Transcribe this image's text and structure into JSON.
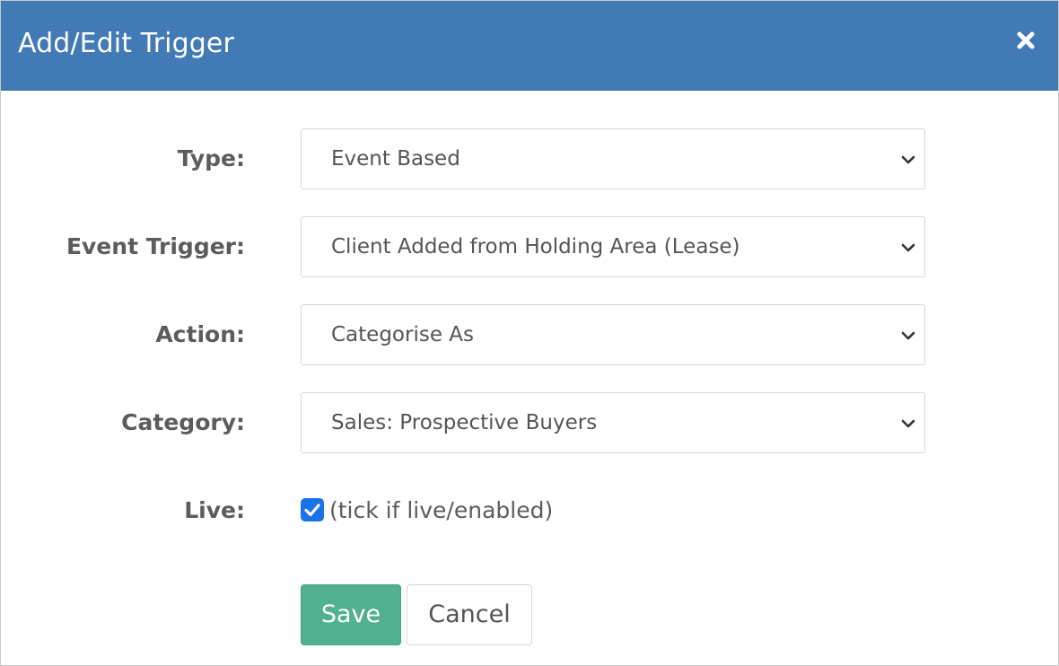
{
  "dialog": {
    "title": "Add/Edit Trigger",
    "close_icon": "close-icon",
    "header_color": "#427ab5"
  },
  "form": {
    "type": {
      "label": "Type:",
      "value": "Event Based"
    },
    "event_trigger": {
      "label": "Event Trigger:",
      "value": "Client Added from Holding Area (Lease)"
    },
    "action": {
      "label": "Action:",
      "value": "Categorise As"
    },
    "category": {
      "label": "Category:",
      "value": "Sales: Prospective Buyers"
    },
    "live": {
      "label": "Live:",
      "checked": true,
      "hint": "(tick if live/enabled)"
    }
  },
  "buttons": {
    "save_label": "Save",
    "save_color": "#50b08f",
    "cancel_label": "Cancel"
  }
}
